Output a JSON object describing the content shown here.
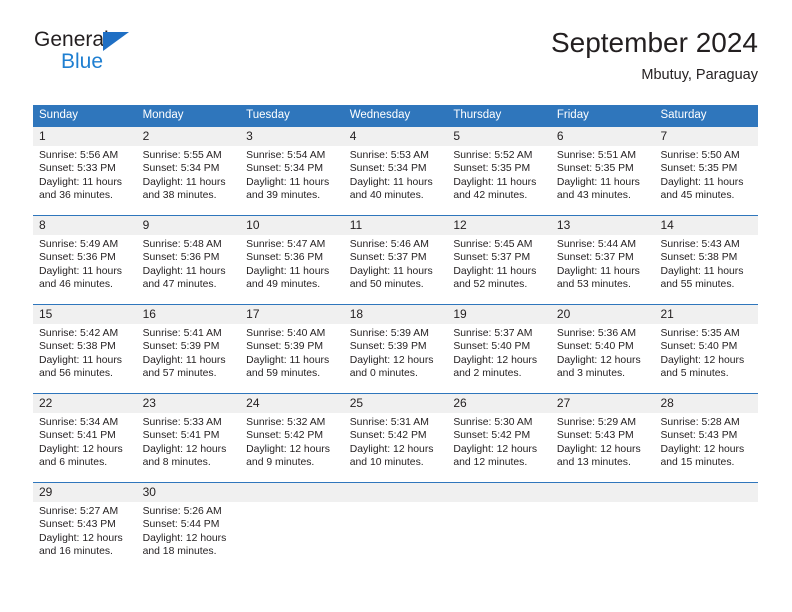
{
  "brand": {
    "name_top": "General",
    "name_bottom": "Blue",
    "triangle_color": "#1f6fc4",
    "blue_color": "#1f7fd1"
  },
  "header": {
    "title": "September 2024",
    "subtitle": "Mbutuy, Paraguay"
  },
  "theme": {
    "header_blue": "#2f76bc",
    "daynum_band": "#f0f0f0",
    "text": "#231f20"
  },
  "weekdays": [
    "Sunday",
    "Monday",
    "Tuesday",
    "Wednesday",
    "Thursday",
    "Friday",
    "Saturday"
  ],
  "weeks": [
    [
      {
        "day": "1",
        "sunrise": "Sunrise: 5:56 AM",
        "sunset": "Sunset: 5:33 PM",
        "daylight1": "Daylight: 11 hours",
        "daylight2": "and 36 minutes."
      },
      {
        "day": "2",
        "sunrise": "Sunrise: 5:55 AM",
        "sunset": "Sunset: 5:34 PM",
        "daylight1": "Daylight: 11 hours",
        "daylight2": "and 38 minutes."
      },
      {
        "day": "3",
        "sunrise": "Sunrise: 5:54 AM",
        "sunset": "Sunset: 5:34 PM",
        "daylight1": "Daylight: 11 hours",
        "daylight2": "and 39 minutes."
      },
      {
        "day": "4",
        "sunrise": "Sunrise: 5:53 AM",
        "sunset": "Sunset: 5:34 PM",
        "daylight1": "Daylight: 11 hours",
        "daylight2": "and 40 minutes."
      },
      {
        "day": "5",
        "sunrise": "Sunrise: 5:52 AM",
        "sunset": "Sunset: 5:35 PM",
        "daylight1": "Daylight: 11 hours",
        "daylight2": "and 42 minutes."
      },
      {
        "day": "6",
        "sunrise": "Sunrise: 5:51 AM",
        "sunset": "Sunset: 5:35 PM",
        "daylight1": "Daylight: 11 hours",
        "daylight2": "and 43 minutes."
      },
      {
        "day": "7",
        "sunrise": "Sunrise: 5:50 AM",
        "sunset": "Sunset: 5:35 PM",
        "daylight1": "Daylight: 11 hours",
        "daylight2": "and 45 minutes."
      }
    ],
    [
      {
        "day": "8",
        "sunrise": "Sunrise: 5:49 AM",
        "sunset": "Sunset: 5:36 PM",
        "daylight1": "Daylight: 11 hours",
        "daylight2": "and 46 minutes."
      },
      {
        "day": "9",
        "sunrise": "Sunrise: 5:48 AM",
        "sunset": "Sunset: 5:36 PM",
        "daylight1": "Daylight: 11 hours",
        "daylight2": "and 47 minutes."
      },
      {
        "day": "10",
        "sunrise": "Sunrise: 5:47 AM",
        "sunset": "Sunset: 5:36 PM",
        "daylight1": "Daylight: 11 hours",
        "daylight2": "and 49 minutes."
      },
      {
        "day": "11",
        "sunrise": "Sunrise: 5:46 AM",
        "sunset": "Sunset: 5:37 PM",
        "daylight1": "Daylight: 11 hours",
        "daylight2": "and 50 minutes."
      },
      {
        "day": "12",
        "sunrise": "Sunrise: 5:45 AM",
        "sunset": "Sunset: 5:37 PM",
        "daylight1": "Daylight: 11 hours",
        "daylight2": "and 52 minutes."
      },
      {
        "day": "13",
        "sunrise": "Sunrise: 5:44 AM",
        "sunset": "Sunset: 5:37 PM",
        "daylight1": "Daylight: 11 hours",
        "daylight2": "and 53 minutes."
      },
      {
        "day": "14",
        "sunrise": "Sunrise: 5:43 AM",
        "sunset": "Sunset: 5:38 PM",
        "daylight1": "Daylight: 11 hours",
        "daylight2": "and 55 minutes."
      }
    ],
    [
      {
        "day": "15",
        "sunrise": "Sunrise: 5:42 AM",
        "sunset": "Sunset: 5:38 PM",
        "daylight1": "Daylight: 11 hours",
        "daylight2": "and 56 minutes."
      },
      {
        "day": "16",
        "sunrise": "Sunrise: 5:41 AM",
        "sunset": "Sunset: 5:39 PM",
        "daylight1": "Daylight: 11 hours",
        "daylight2": "and 57 minutes."
      },
      {
        "day": "17",
        "sunrise": "Sunrise: 5:40 AM",
        "sunset": "Sunset: 5:39 PM",
        "daylight1": "Daylight: 11 hours",
        "daylight2": "and 59 minutes."
      },
      {
        "day": "18",
        "sunrise": "Sunrise: 5:39 AM",
        "sunset": "Sunset: 5:39 PM",
        "daylight1": "Daylight: 12 hours",
        "daylight2": "and 0 minutes."
      },
      {
        "day": "19",
        "sunrise": "Sunrise: 5:37 AM",
        "sunset": "Sunset: 5:40 PM",
        "daylight1": "Daylight: 12 hours",
        "daylight2": "and 2 minutes."
      },
      {
        "day": "20",
        "sunrise": "Sunrise: 5:36 AM",
        "sunset": "Sunset: 5:40 PM",
        "daylight1": "Daylight: 12 hours",
        "daylight2": "and 3 minutes."
      },
      {
        "day": "21",
        "sunrise": "Sunrise: 5:35 AM",
        "sunset": "Sunset: 5:40 PM",
        "daylight1": "Daylight: 12 hours",
        "daylight2": "and 5 minutes."
      }
    ],
    [
      {
        "day": "22",
        "sunrise": "Sunrise: 5:34 AM",
        "sunset": "Sunset: 5:41 PM",
        "daylight1": "Daylight: 12 hours",
        "daylight2": "and 6 minutes."
      },
      {
        "day": "23",
        "sunrise": "Sunrise: 5:33 AM",
        "sunset": "Sunset: 5:41 PM",
        "daylight1": "Daylight: 12 hours",
        "daylight2": "and 8 minutes."
      },
      {
        "day": "24",
        "sunrise": "Sunrise: 5:32 AM",
        "sunset": "Sunset: 5:42 PM",
        "daylight1": "Daylight: 12 hours",
        "daylight2": "and 9 minutes."
      },
      {
        "day": "25",
        "sunrise": "Sunrise: 5:31 AM",
        "sunset": "Sunset: 5:42 PM",
        "daylight1": "Daylight: 12 hours",
        "daylight2": "and 10 minutes."
      },
      {
        "day": "26",
        "sunrise": "Sunrise: 5:30 AM",
        "sunset": "Sunset: 5:42 PM",
        "daylight1": "Daylight: 12 hours",
        "daylight2": "and 12 minutes."
      },
      {
        "day": "27",
        "sunrise": "Sunrise: 5:29 AM",
        "sunset": "Sunset: 5:43 PM",
        "daylight1": "Daylight: 12 hours",
        "daylight2": "and 13 minutes."
      },
      {
        "day": "28",
        "sunrise": "Sunrise: 5:28 AM",
        "sunset": "Sunset: 5:43 PM",
        "daylight1": "Daylight: 12 hours",
        "daylight2": "and 15 minutes."
      }
    ],
    [
      {
        "day": "29",
        "sunrise": "Sunrise: 5:27 AM",
        "sunset": "Sunset: 5:43 PM",
        "daylight1": "Daylight: 12 hours",
        "daylight2": "and 16 minutes."
      },
      {
        "day": "30",
        "sunrise": "Sunrise: 5:26 AM",
        "sunset": "Sunset: 5:44 PM",
        "daylight1": "Daylight: 12 hours",
        "daylight2": "and 18 minutes."
      },
      {
        "day": "",
        "sunrise": "",
        "sunset": "",
        "daylight1": "",
        "daylight2": ""
      },
      {
        "day": "",
        "sunrise": "",
        "sunset": "",
        "daylight1": "",
        "daylight2": ""
      },
      {
        "day": "",
        "sunrise": "",
        "sunset": "",
        "daylight1": "",
        "daylight2": ""
      },
      {
        "day": "",
        "sunrise": "",
        "sunset": "",
        "daylight1": "",
        "daylight2": ""
      },
      {
        "day": "",
        "sunrise": "",
        "sunset": "",
        "daylight1": "",
        "daylight2": ""
      }
    ]
  ]
}
